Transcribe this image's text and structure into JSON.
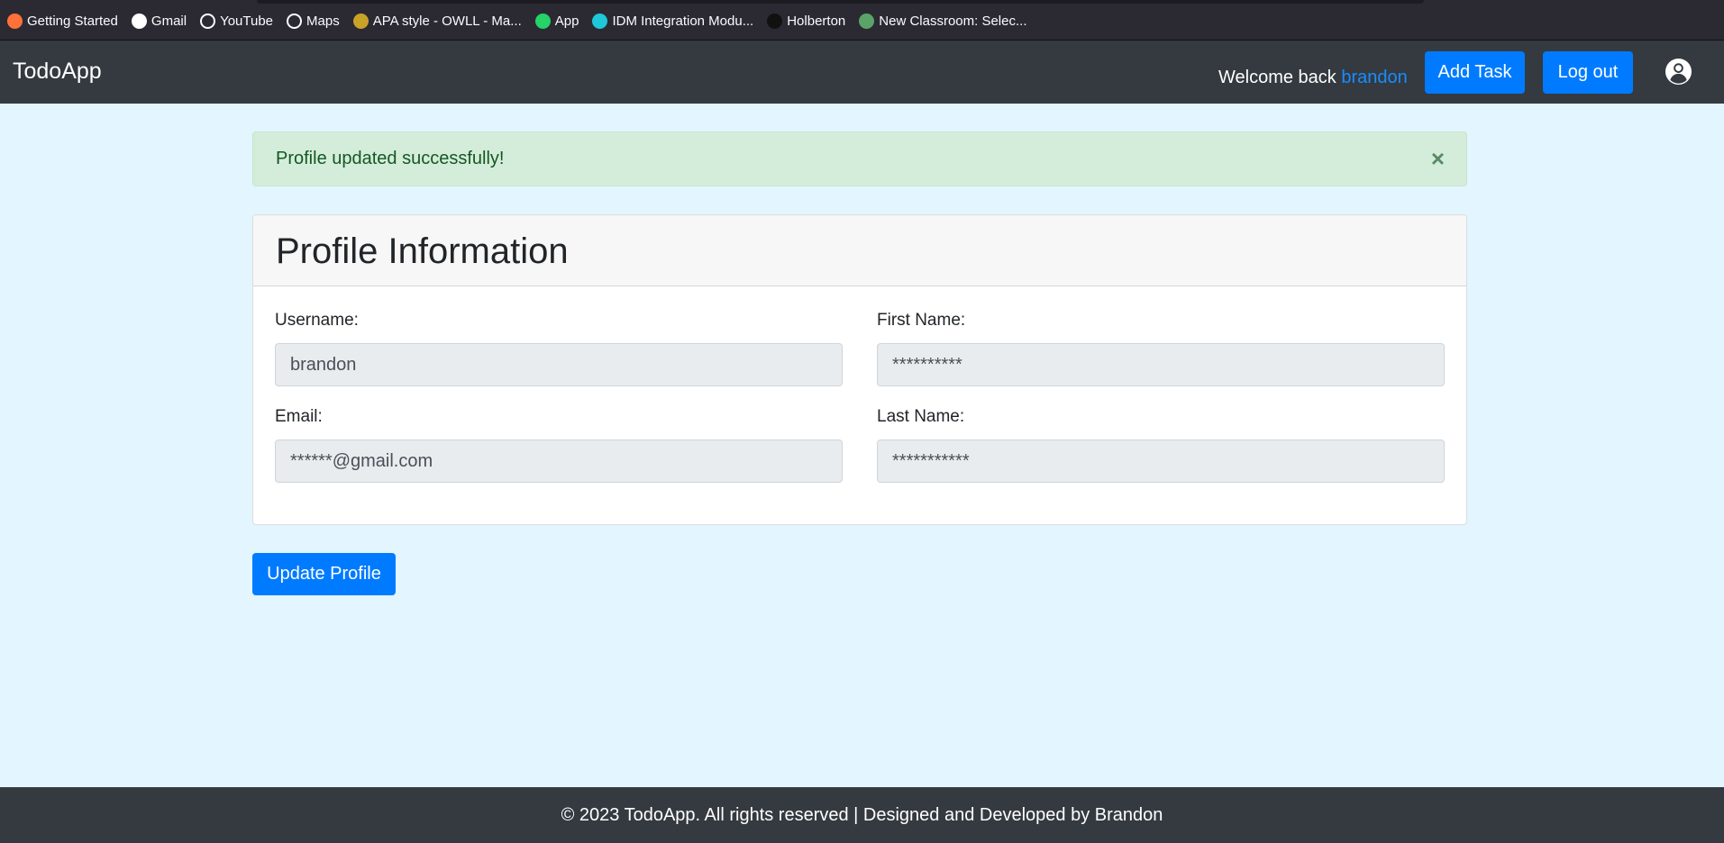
{
  "bookmarks": [
    {
      "label": "Getting Started",
      "icon": "firefox-icon",
      "color": "#ff7139"
    },
    {
      "label": "Gmail",
      "icon": "google-icon",
      "color": "#ffffff"
    },
    {
      "label": "YouTube",
      "icon": "globe-icon",
      "color": "#2b2a33"
    },
    {
      "label": "Maps",
      "icon": "globe-icon",
      "color": "#2b2a33"
    },
    {
      "label": "APA style - OWLL - Ma...",
      "icon": "crest-icon",
      "color": "#c9a227"
    },
    {
      "label": "App",
      "icon": "whatsapp-icon",
      "color": "#25d366"
    },
    {
      "label": "IDM Integration Modu...",
      "icon": "idm-icon",
      "color": "#1ec8d8"
    },
    {
      "label": "Holberton",
      "icon": "github-icon",
      "color": "#111111"
    },
    {
      "label": "New Classroom: Selec...",
      "icon": "github-classroom-icon",
      "color": "#5aa469"
    }
  ],
  "navbar": {
    "brand": "TodoApp",
    "welcome": "Welcome back ",
    "username": "brandon",
    "add_task": "Add Task",
    "logout": "Log out"
  },
  "alert": {
    "message": "Profile updated successfully!",
    "close": "×"
  },
  "card": {
    "title": "Profile Information",
    "fields": {
      "username": {
        "label": "Username:",
        "value": "brandon"
      },
      "first_name": {
        "label": "First Name:",
        "value": "**********"
      },
      "email": {
        "label": "Email:",
        "value": "******@gmail.com"
      },
      "last_name": {
        "label": "Last Name:",
        "value": "***********"
      }
    }
  },
  "update_button": "Update Profile",
  "footer": "© 2023 TodoApp. All rights reserved | Designed and Developed by Brandon",
  "colors": {
    "primary": "#007bff",
    "navbar": "#343a40",
    "background": "#e3f5fe",
    "success_bg": "#d4edda"
  }
}
